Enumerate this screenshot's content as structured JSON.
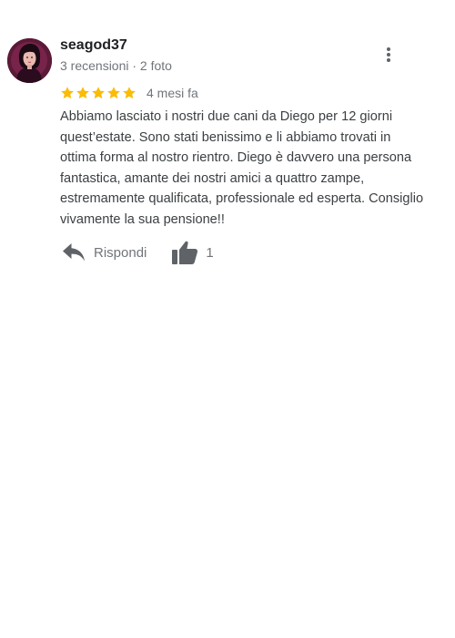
{
  "review": {
    "author_name": "seagod37",
    "author_meta": "3 recensioni · 2 foto",
    "rating": 5,
    "rating_max": 5,
    "date": "4 mesi fa",
    "text": "Abbiamo lasciato i nostri due cani da Diego per 12 giorni quest’estate. Sono stati benissimo e li abbiamo trovati in ottima forma al nostro rientro. Diego è davvero una persona fantastica, amante dei nostri amici a quattro zampe, estremamente qualificata, professionale ed esperta. Consiglio vivamente la sua pensione!!",
    "reply_label": "Rispondi",
    "like_count": "1"
  },
  "colors": {
    "star": "#fbbc04",
    "secondary_text": "#70757a",
    "body_text": "#3c4043",
    "icon": "#5f6368"
  },
  "icons": {
    "more": "more-vert-icon",
    "reply": "reply-arrow-icon",
    "like": "thumb-up-icon",
    "star": "star-icon"
  }
}
